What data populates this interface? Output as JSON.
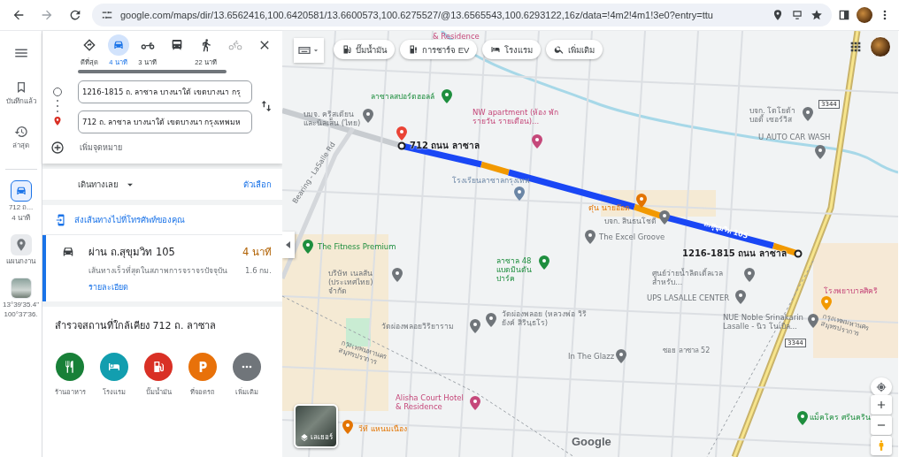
{
  "browser": {
    "url": "google.com/maps/dir/13.6562416,100.6420581/13.6600573,100.6275527/@13.6565543,100.6293122,16z/data=!4m2!4m1!3e0?entry=ttu"
  },
  "rail": {
    "items": [
      {
        "kind": "saved",
        "label": "บันทึกแล้ว"
      },
      {
        "kind": "recent",
        "label": "ล่าสุด"
      }
    ],
    "history": [
      {
        "kind": "route",
        "lines": [
          "712 ถ...",
          "4 นาที"
        ],
        "selected": true
      },
      {
        "kind": "place",
        "lines": [
          "แผนกงาน"
        ],
        "selected": false
      },
      {
        "kind": "photo",
        "lines": [
          "13°39'35.4\"",
          "100°37'36."
        ],
        "selected": false
      }
    ]
  },
  "directions": {
    "modes": [
      {
        "kind": "best",
        "label": "ดีที่สุด",
        "selected": false,
        "disabled": false
      },
      {
        "kind": "car",
        "label": "4 นาที",
        "selected": true,
        "disabled": false
      },
      {
        "kind": "moto",
        "label": "3 นาที",
        "selected": false,
        "disabled": false
      },
      {
        "kind": "transit",
        "selected": false,
        "disabled": false
      },
      {
        "kind": "walk",
        "label": "22 นาที",
        "selected": false,
        "disabled": false
      },
      {
        "kind": "bike",
        "selected": false,
        "disabled": true
      }
    ],
    "origin": {
      "value": "1216-1815 ถ. ลาซาล บางนาใต้ เขตบางนา กรุ"
    },
    "destination": {
      "value": "712 ถ. ลาซาล บางนาใต้ เขตบางนา กรุงเทพมห"
    },
    "add_destination": "เพิ่มจุดหมาย",
    "depart": "เดินทางเลย",
    "options": "ตัวเลือก",
    "send_to_phone": "ส่งเส้นทางไปที่โทรศัพท์ของคุณ",
    "routes": [
      {
        "via": "ผ่าน ถ.สุขุมวิท 105",
        "time": "4 นาที",
        "note": "เส้นทางเร็วที่สุดในสภาพการจราจรปัจจุบัน",
        "distance": "1.6 กม.",
        "details": "รายละเอียด",
        "selected": true
      }
    ],
    "explore": {
      "title": "สำรวจสถานที่ใกล้เคียง 712 ถ. ลาซาล",
      "categories": [
        {
          "kind": "restaurant",
          "label": "ร้านอาหาร",
          "color": "#188038"
        },
        {
          "kind": "hotel",
          "label": "โรงแรม",
          "color": "#129eaf"
        },
        {
          "kind": "fuel",
          "label": "ปั๊มน้ำมัน",
          "color": "#d93025"
        },
        {
          "kind": "parking",
          "label": "ที่จอดรถ",
          "color": "#e8710a"
        },
        {
          "kind": "more",
          "label": "เพิ่มเติม",
          "color": "#70757a"
        }
      ]
    }
  },
  "map": {
    "chips": [
      {
        "kind": "fuel",
        "label": "ปั๊มน้ำมัน"
      },
      {
        "kind": "ev",
        "label": "การชาร์จ EV"
      },
      {
        "kind": "hotel",
        "label": "โรงแรม"
      },
      {
        "kind": "search",
        "label": "เพิ่มเติม"
      }
    ],
    "route_segments": [
      {
        "color": "#1a47f5"
      },
      {
        "color": "#f29900"
      },
      {
        "color": "#1a47f5"
      },
      {
        "color": "#f29900"
      },
      {
        "color": "#1a47f5"
      },
      {
        "color": "#f29900"
      }
    ],
    "labels": [
      {
        "kind": "place",
        "text": "& Residence"
      },
      {
        "kind": "poi",
        "text": "ลาซาลสปอร์ตฮอลล์",
        "color": "#1e8e3e"
      },
      {
        "kind": "poi",
        "text": "บมจ. คริสเตียน และนีลเส็น (ไทย)",
        "color": "#70757a"
      },
      {
        "kind": "poi",
        "text": "NW apartment (ห้อง พักรายวัน รายเดือน)...",
        "color": "#c5487a"
      },
      {
        "kind": "road",
        "text": "Bearing - LaSalle Rd"
      },
      {
        "kind": "endpoint",
        "text": "712 ถนน ลาซาล"
      },
      {
        "kind": "poi",
        "text": "โรงเรียนลาซาลกรุงเทพ",
        "color": "#6b86a6"
      },
      {
        "kind": "poi",
        "text": "ตุ๋น นายอ๊อด",
        "color": "#e37400"
      },
      {
        "kind": "poi",
        "text": "บจก. สินธนโชติ",
        "color": "#70757a"
      },
      {
        "kind": "poi",
        "text": "The Fitness Premium",
        "color": "#1e8e3e"
      },
      {
        "kind": "poi",
        "text": "The Excel Groove",
        "color": "#70757a"
      },
      {
        "kind": "route-name",
        "text": "ถ.สุขุมวิท 105"
      },
      {
        "kind": "poi",
        "text": "บจก. โตโยต้า บอดี้ เซอร์วิส",
        "color": "#70757a"
      },
      {
        "kind": "poi",
        "text": "U AUTO CAR WASH",
        "color": "#70757a"
      },
      {
        "kind": "endpoint",
        "text": "1216-1815 ถนน ลาซาล"
      },
      {
        "kind": "poi",
        "text": "ลาซาล 48 แบดมินตันปาร์ค",
        "color": "#1e8e3e"
      },
      {
        "kind": "poi",
        "text": "บริษัท เนลสัน (ประเทศไทย) จำกัด",
        "color": "#70757a"
      },
      {
        "kind": "poi",
        "text": "ศูนย์ว่ายน้ำลิตเติ้ลเวล สำหรับ...",
        "color": "#70757a"
      },
      {
        "kind": "poi",
        "text": "UPS LASALLE CENTER",
        "color": "#70757a"
      },
      {
        "kind": "poi",
        "text": "วัดผ่องพลอยวิริยาราม",
        "color": "#70757a"
      },
      {
        "kind": "poi",
        "text": "วัดผ่องพลอย (หลวงพ่อ วิริยังค์ สิรินฺธโร)",
        "color": "#70757a"
      },
      {
        "kind": "poi",
        "text": "NUE Noble Srinakarin Lasalle - นิว โนเบิล...",
        "color": "#70757a"
      },
      {
        "kind": "place",
        "text": "โรงพยาบาลศิคริ"
      },
      {
        "kind": "road",
        "text": "กรุงเทพมหานคร สมุทรปราการ"
      },
      {
        "kind": "road",
        "text": "ซอย ลาซาล 52"
      },
      {
        "kind": "poi",
        "text": "In The Glazz",
        "color": "#70757a"
      },
      {
        "kind": "road",
        "text": "กรุงเทพมหานคร สมุทรปราการ"
      },
      {
        "kind": "poi",
        "text": "Alisha Court Hotel & Residence",
        "color": "#c5487a"
      },
      {
        "kind": "poi",
        "text": "วีที แหนมเนือง",
        "color": "#e37400"
      },
      {
        "kind": "poi",
        "text": "แม็คโคร ศรีนคริน",
        "color": "#1e8e3e"
      }
    ],
    "road_shields": [
      "3344",
      "3344"
    ],
    "layers_label": "เลเยอร์",
    "logo": "Google"
  }
}
